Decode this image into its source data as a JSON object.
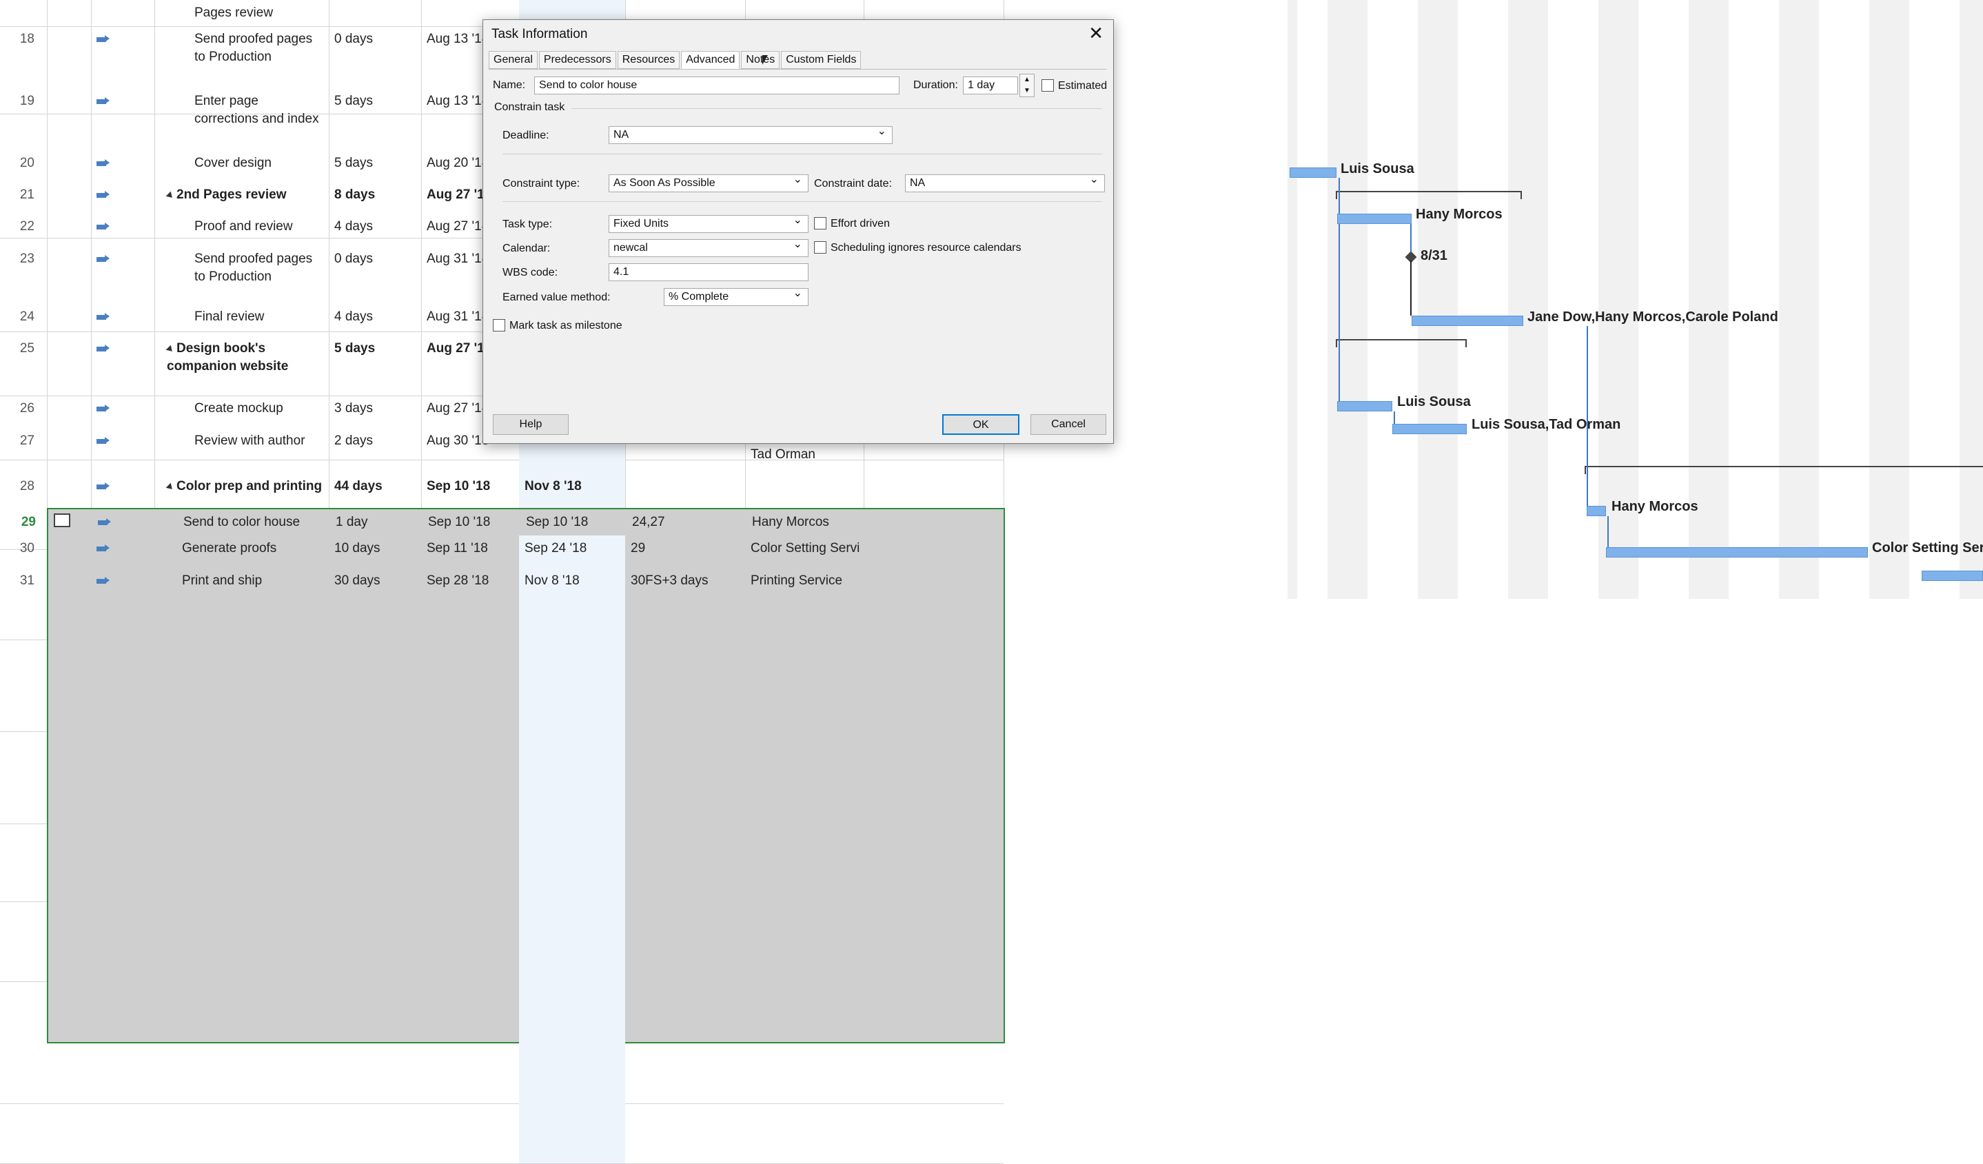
{
  "table": {
    "rows": [
      {
        "id": "",
        "name": "Pages review",
        "duration": "",
        "start": "",
        "finish": "",
        "pred": "",
        "res": "",
        "bold": false,
        "summary": false
      },
      {
        "id": "18",
        "name": "Send proofed pages to Production",
        "duration": "0 days",
        "start": "Aug 13 '18",
        "finish": "",
        "pred": "",
        "res": "",
        "bold": false,
        "summary": false
      },
      {
        "id": "19",
        "name": "Enter page corrections and index",
        "duration": "5 days",
        "start": "Aug 13 '18",
        "finish": "",
        "pred": "",
        "res": "",
        "bold": false,
        "summary": false
      },
      {
        "id": "20",
        "name": "Cover design",
        "duration": "5 days",
        "start": "Aug 20 '18",
        "finish": "",
        "pred": "",
        "res": "",
        "bold": false,
        "summary": false
      },
      {
        "id": "21",
        "name": "2nd Pages review",
        "duration": "8 days",
        "start": "Aug 27 '18",
        "finish": "",
        "pred": "",
        "res": "",
        "bold": true,
        "summary": true
      },
      {
        "id": "22",
        "name": "Proof and review",
        "duration": "4 days",
        "start": "Aug 27 '18",
        "finish": "",
        "pred": "",
        "res": "",
        "bold": false,
        "summary": false
      },
      {
        "id": "23",
        "name": "Send proofed pages to Production",
        "duration": "0 days",
        "start": "Aug 31 '18",
        "finish": "",
        "pred": "",
        "res": "",
        "bold": false,
        "summary": false
      },
      {
        "id": "24",
        "name": "Final review",
        "duration": "4 days",
        "start": "Aug 31 '18",
        "finish": "",
        "pred": "",
        "res": "",
        "bold": false,
        "summary": false
      },
      {
        "id": "25",
        "name": "Design book's companion website",
        "duration": "5 days",
        "start": "Aug 27 '18",
        "finish": "",
        "pred": "",
        "res": "",
        "bold": true,
        "summary": true
      },
      {
        "id": "26",
        "name": "Create mockup",
        "duration": "3 days",
        "start": "Aug 27 '18",
        "finish": "",
        "pred": "",
        "res": "",
        "bold": false,
        "summary": false
      },
      {
        "id": "27",
        "name": "Review with author",
        "duration": "2 days",
        "start": "Aug 30 '18",
        "finish": "",
        "pred": "",
        "res": "Tad Orman",
        "bold": false,
        "summary": false
      },
      {
        "id": "28",
        "name": "Color prep and printing",
        "duration": "44 days",
        "start": "Sep 10 '18",
        "finish": "Nov 8 '18",
        "pred": "",
        "res": "",
        "bold": true,
        "summary": true
      },
      {
        "id": "29",
        "name": "Send to color house",
        "duration": "1 day",
        "start": "Sep 10 '18",
        "finish": "Sep 10 '18",
        "pred": "24,27",
        "res": "Hany Morcos",
        "bold": false,
        "summary": false,
        "selected": true
      },
      {
        "id": "30",
        "name": "Generate proofs",
        "duration": "10 days",
        "start": "Sep 11 '18",
        "finish": "Sep 24 '18",
        "pred": "29",
        "res": "Color Setting Servi",
        "bold": false,
        "summary": false
      },
      {
        "id": "31",
        "name": "Print and ship",
        "duration": "30 days",
        "start": "Sep 28 '18",
        "finish": "Nov 8 '18",
        "pred": "30FS+3 days",
        "res": "Printing Service",
        "bold": false,
        "summary": false
      }
    ]
  },
  "gantt": {
    "labels": {
      "l20": "Luis Sousa",
      "l22": "Hany Morcos",
      "l23": "8/31",
      "l24": "Jane Dow,Hany Morcos,Carole Poland",
      "l26": "Luis Sousa",
      "l27": "Luis Sousa,Tad Orman",
      "l29": "Hany Morcos",
      "l30": "Color Setting Ser"
    }
  },
  "dialog": {
    "title": "Task Information",
    "close": "✕",
    "tabs": [
      "General",
      "Predecessors",
      "Resources",
      "Advanced",
      "Notes",
      "Custom Fields"
    ],
    "active_tab": "Advanced",
    "name_label": "Name:",
    "name_value": "Send to color house",
    "duration_label": "Duration:",
    "duration_value": "1 day",
    "estimated_label": "Estimated",
    "constrain_section": "Constrain task",
    "deadline_label": "Deadline:",
    "deadline_value": "NA",
    "constraint_type_label": "Constraint type:",
    "constraint_type_value": "As Soon As Possible",
    "constraint_date_label": "Constraint date:",
    "constraint_date_value": "NA",
    "task_type_label": "Task type:",
    "task_type_value": "Fixed Units",
    "effort_driven_label": "Effort driven",
    "calendar_label": "Calendar:",
    "calendar_value": "newcal",
    "sched_ignores_label": "Scheduling ignores resource calendars",
    "wbs_label": "WBS code:",
    "wbs_value": "4.1",
    "earned_value_label": "Earned value method:",
    "earned_value_value": "% Complete",
    "milestone_label": "Mark task as milestone",
    "help_button": "Help",
    "ok_button": "OK",
    "cancel_button": "Cancel"
  }
}
